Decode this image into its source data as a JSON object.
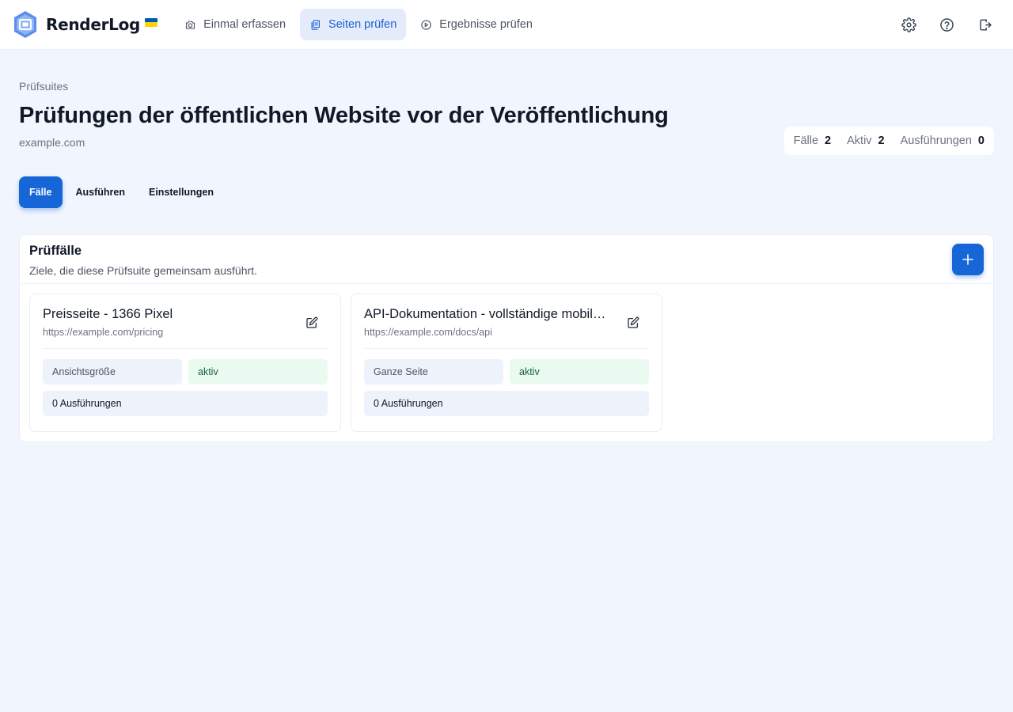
{
  "app": {
    "name": "RenderLog",
    "accent": "#1766d8",
    "logo_color": "#5b8def"
  },
  "nav": {
    "items": [
      {
        "label": "Einmal erfassen",
        "icon": "camera-icon",
        "active": false
      },
      {
        "label": "Seiten prüfen",
        "icon": "copy-pages-icon",
        "active": true
      },
      {
        "label": "Ergebnisse prüfen",
        "icon": "play-circle-icon",
        "active": false
      }
    ],
    "actions": [
      {
        "icon": "gear-icon"
      },
      {
        "icon": "help-icon"
      },
      {
        "icon": "logout-icon"
      }
    ]
  },
  "page": {
    "breadcrumb": "Prüfsuites",
    "title": "Prüfungen der öffentlichen Website vor der Veröffentlichung",
    "domain": "example.com"
  },
  "stats": [
    {
      "label": "Fälle",
      "value": "2"
    },
    {
      "label": "Aktiv",
      "value": "2"
    },
    {
      "label": "Ausführungen",
      "value": "0"
    }
  ],
  "tabs": [
    {
      "label": "Fälle",
      "active": true
    },
    {
      "label": "Ausführen",
      "active": false
    },
    {
      "label": "Einstellungen",
      "active": false
    }
  ],
  "panel": {
    "title": "Prüffälle",
    "subtitle": "Ziele, die diese Prüfsuite gemeinsam ausführt.",
    "add_icon": "plus-icon"
  },
  "cases": [
    {
      "title": "Preisseite - 1366 Pixel",
      "url": "https://example.com/pricing",
      "mode": "Ansichtsgröße",
      "status": "aktiv",
      "runs": "0 Ausführungen"
    },
    {
      "title": "API-Dokumentation - vollständige mobile Seite",
      "url": "https://example.com/docs/api",
      "mode": "Ganze Seite",
      "status": "aktiv",
      "runs": "0 Ausführungen"
    }
  ]
}
